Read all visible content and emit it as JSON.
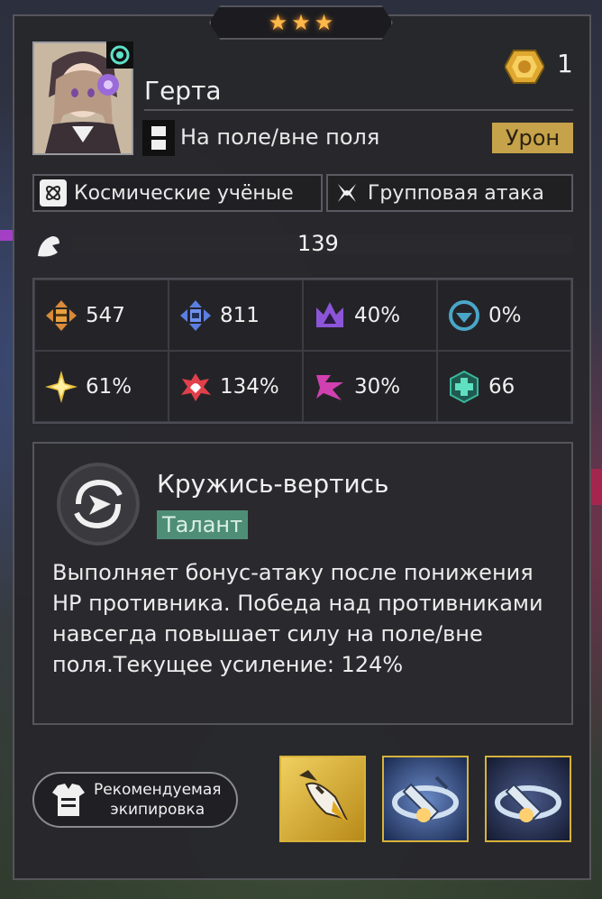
{
  "stars": [
    "★",
    "★",
    "★"
  ],
  "character": {
    "name": "Герта",
    "path_label": "На поле/вне поля",
    "role_badge": "Урон",
    "currency_count": "1",
    "element_icon": "circle-dot-icon"
  },
  "tags": [
    {
      "label": "Космические учёные",
      "icon": "scholars-icon"
    },
    {
      "label": "Групповая атака",
      "icon": "aoe-attack-icon"
    }
  ],
  "level": {
    "value": "139",
    "icon": "level-icon"
  },
  "stats": [
    {
      "value": "547",
      "icon": "attack-icon",
      "color": "#d98a3a"
    },
    {
      "value": "811",
      "icon": "defense-icon",
      "color": "#5b7fe0"
    },
    {
      "value": "40%",
      "icon": "crown-icon",
      "color": "#8c55d8"
    },
    {
      "value": "0%",
      "icon": "shield-icon",
      "color": "#4aa6c8"
    },
    {
      "value": "61%",
      "icon": "crit-rate-icon",
      "color": "#e8c040"
    },
    {
      "value": "134%",
      "icon": "crit-dmg-icon",
      "color": "#e0404a"
    },
    {
      "value": "30%",
      "icon": "break-icon",
      "color": "#d040b0"
    },
    {
      "value": "66",
      "icon": "heal-icon",
      "color": "#38b89c"
    }
  ],
  "talent": {
    "name": "Кружись-вертись",
    "type": "Талант",
    "description": "Выполняет бонус-атаку после понижения HP противника. Победа над противниками навсегда повышает силу на поле/вне поля.Текущее усиление: 124%"
  },
  "recommend": {
    "line1": "Рекомендуемая",
    "line2": "экипировка"
  },
  "relics": [
    {
      "icon": "rocket-relic-icon",
      "bg": "#c9a02a"
    },
    {
      "icon": "satellite-relic-icon",
      "bg": "#3a5a9a"
    },
    {
      "icon": "satellite-relic-icon",
      "bg": "#2a3450"
    }
  ]
}
